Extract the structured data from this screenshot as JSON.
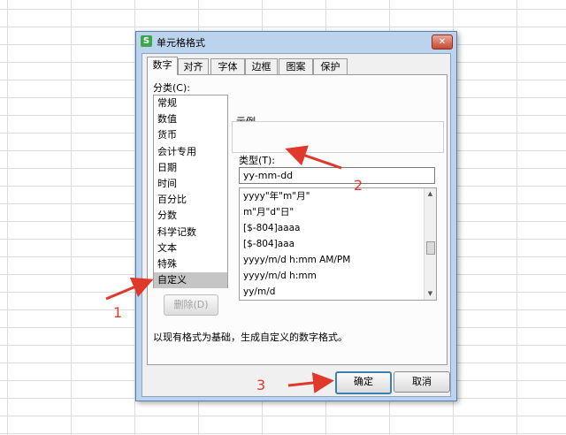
{
  "dialog": {
    "title": "单元格格式",
    "app_icon": "S",
    "close_glyph": "✕"
  },
  "tabs": [
    "数字",
    "对齐",
    "字体",
    "边框",
    "图案",
    "保护"
  ],
  "category": {
    "label": "分类(C):",
    "items": [
      "常规",
      "数值",
      "货币",
      "会计专用",
      "日期",
      "时间",
      "百分比",
      "分数",
      "科学记数",
      "文本",
      "特殊",
      "自定义"
    ],
    "selected": "自定义"
  },
  "sample": {
    "label": "示例"
  },
  "type": {
    "label": "类型(T):",
    "value": "yy-mm-dd",
    "formats": [
      "yyyy\"年\"m\"月\"",
      "m\"月\"d\"日\"",
      "[$-804]aaaa",
      "[$-804]aaa",
      "yyyy/m/d h:mm AM/PM",
      "yyyy/m/d h:mm",
      "yy/m/d"
    ]
  },
  "buttons": {
    "delete": "删除(D)",
    "ok": "确定",
    "cancel": "取消"
  },
  "description": "以现有格式为基础，生成自定义的数字格式。",
  "annotations": {
    "step1": "1",
    "step2": "2",
    "step3": "3"
  },
  "colors": {
    "annotation": "#e0392b",
    "titlebar": "#bcd3ee",
    "selection": "#c5c5c5"
  }
}
